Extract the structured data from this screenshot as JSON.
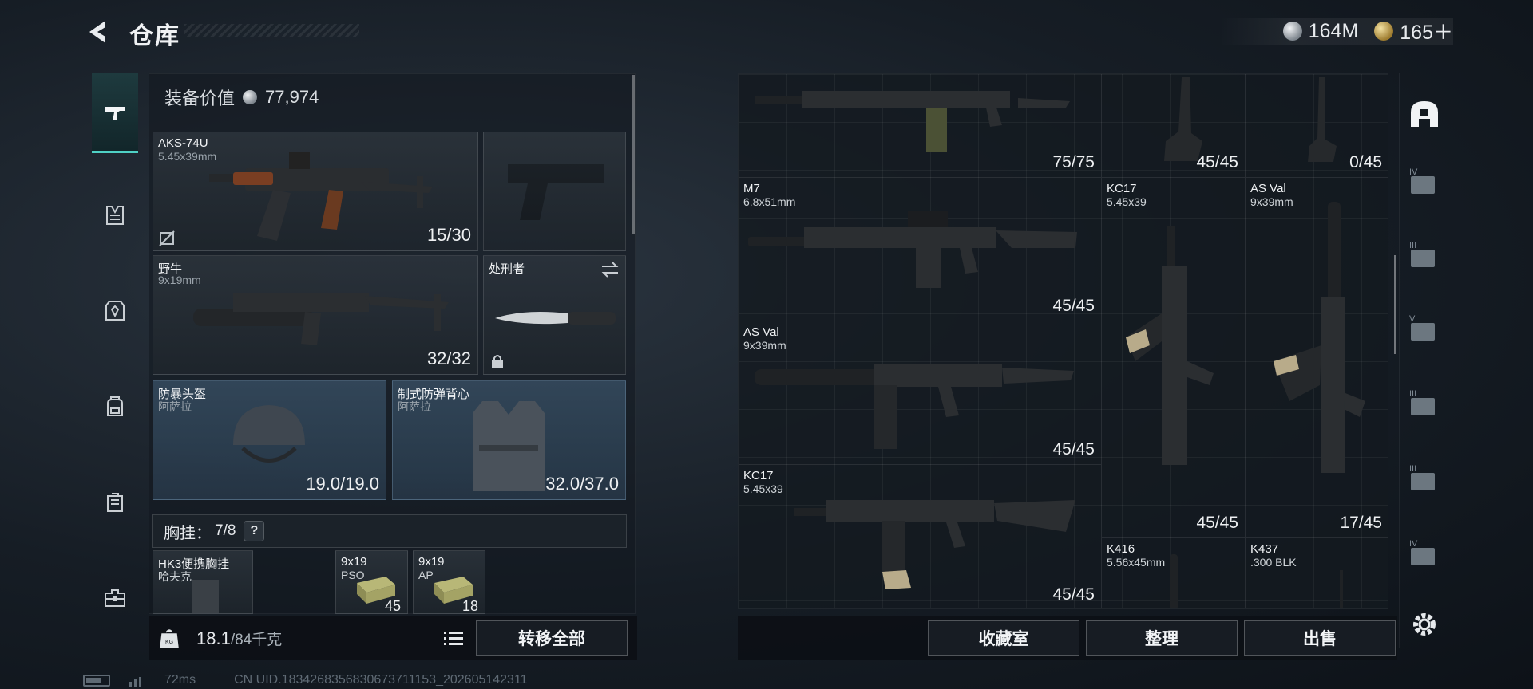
{
  "header": {
    "title": "仓库"
  },
  "currency": [
    {
      "icon": "silver-coin-icon",
      "amount": "164M"
    },
    {
      "icon": "gold-coin-icon",
      "amount": "165＋"
    }
  ],
  "left": {
    "equip_value_label": "装备价值",
    "equip_value": "77,974",
    "slots": {
      "primary": {
        "name": "AKS-74U",
        "sub": "5.45x39mm",
        "count": "15/30"
      },
      "sidearm": {
        "name": "",
        "sub": "",
        "count": ""
      },
      "secondary": {
        "name": "野牛",
        "sub": "9x19mm",
        "count": "32/32"
      },
      "melee": {
        "name": "处刑者",
        "sub": "",
        "count": ""
      },
      "helmet": {
        "name": "防暴头盔",
        "sub": "阿萨拉",
        "count": "19.0/19.0"
      },
      "armor": {
        "name": "制式防弹背心",
        "sub": "阿萨拉",
        "count": "32.0/37.0"
      }
    },
    "chest_rig": {
      "label": "胸挂：",
      "capacity": "7/8",
      "help": "?"
    },
    "rig_items": [
      {
        "name": "HK3便携胸挂",
        "sub": "哈夫克"
      },
      {
        "name": "9x19",
        "sub": "PSO",
        "count": "45"
      },
      {
        "name": "9x19",
        "sub": "AP",
        "count": "18"
      }
    ],
    "weight": {
      "value": "18.1",
      "max": "/84千克"
    },
    "transfer_all": "转移全部"
  },
  "grid": {
    "cells": [
      {
        "name": "",
        "sub": "",
        "count": "75/75"
      },
      {
        "name": "",
        "sub": "",
        "count": "45/45"
      },
      {
        "name": "",
        "sub": "",
        "count": "0/45"
      },
      {
        "name": "M7",
        "sub": "6.8x51mm",
        "count": "45/45"
      },
      {
        "name": "KC17",
        "sub": "5.45x39",
        "count": "45/45"
      },
      {
        "name": "AS Val",
        "sub": "9x39mm",
        "count": "17/45"
      },
      {
        "name": "AS Val",
        "sub": "9x39mm",
        "count": "45/45"
      },
      {
        "name": "KC17",
        "sub": "5.45x39",
        "count": "45/45"
      },
      {
        "name": "K416",
        "sub": "5.56x45mm",
        "count": ""
      },
      {
        "name": "K437",
        "sub": ".300 BLK",
        "count": ""
      }
    ]
  },
  "footer": {
    "collection": "收藏室",
    "sort": "整理",
    "sell": "出售"
  },
  "right_rail": [
    {
      "icon": "helmet-category-icon"
    },
    {
      "icon": "armor-level-4-icon",
      "level": "IV"
    },
    {
      "icon": "armor-level-3-icon",
      "level": "III"
    },
    {
      "icon": "armor-level-5-icon",
      "level": "V"
    },
    {
      "icon": "armor-level-3-icon",
      "level": "III"
    },
    {
      "icon": "armor-level-3-icon",
      "level": "III"
    },
    {
      "icon": "armor-level-4-icon",
      "level": "IV"
    },
    {
      "icon": "settings-gear-icon"
    }
  ],
  "status": {
    "ping": "72ms",
    "uid": "CN UID.1834268356830673711153_202605142311"
  },
  "colors": {
    "accent": "#4fd1c5",
    "armor_slot": "#3a5268",
    "panel": "#141a20"
  }
}
